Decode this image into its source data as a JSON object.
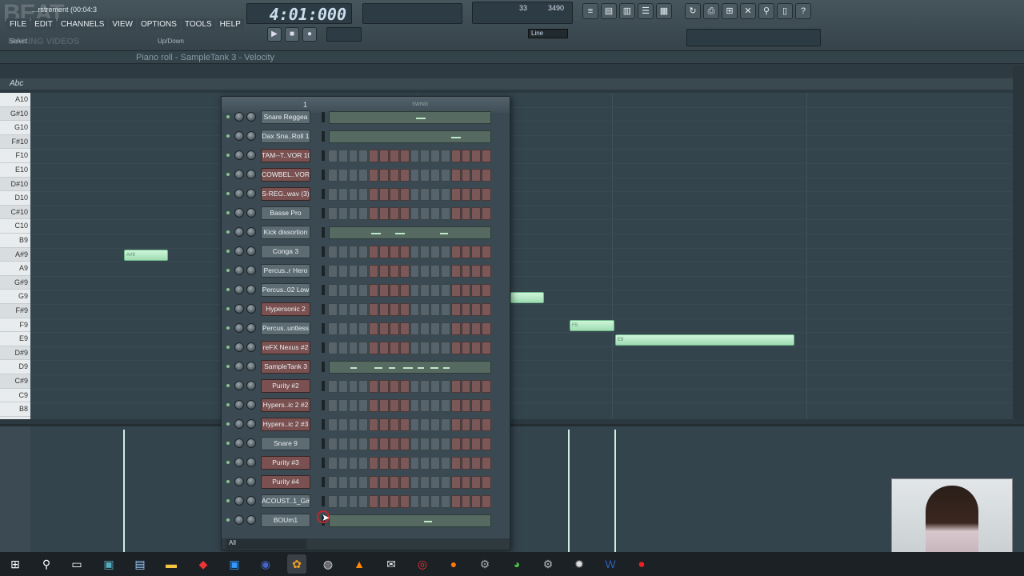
{
  "topbar": {
    "watermark": "BEAT",
    "watermark_sub": "MAKING VIDEOS",
    "hint": "...rstrement (00:04:3",
    "menu": [
      "FILE",
      "EDIT",
      "CHANNELS",
      "VIEW",
      "OPTIONS",
      "TOOLS",
      "HELP"
    ],
    "select_label": "Select",
    "updown_label": "Up/Down",
    "time": "4:01:000",
    "cpu_value": "33",
    "mem_value": "3490",
    "line_select": "Line"
  },
  "piano_roll": {
    "title": "Piano roll - SampleTank 3 - Velocity",
    "abc_label": "Abc",
    "keys": [
      {
        "label": "A10",
        "sharp": false
      },
      {
        "label": "G#10",
        "sharp": true
      },
      {
        "label": "G10",
        "sharp": false
      },
      {
        "label": "F#10",
        "sharp": true
      },
      {
        "label": "F10",
        "sharp": false
      },
      {
        "label": "E10",
        "sharp": false
      },
      {
        "label": "D#10",
        "sharp": true
      },
      {
        "label": "D10",
        "sharp": false
      },
      {
        "label": "C#10",
        "sharp": true
      },
      {
        "label": "C10",
        "sharp": false
      },
      {
        "label": "B9",
        "sharp": false
      },
      {
        "label": "A#9",
        "sharp": true
      },
      {
        "label": "A9",
        "sharp": false
      },
      {
        "label": "G#9",
        "sharp": true
      },
      {
        "label": "G9",
        "sharp": false
      },
      {
        "label": "F#9",
        "sharp": true
      },
      {
        "label": "F9",
        "sharp": false
      },
      {
        "label": "E9",
        "sharp": false
      },
      {
        "label": "D#9",
        "sharp": true
      },
      {
        "label": "D9",
        "sharp": false
      },
      {
        "label": "C#9",
        "sharp": true
      },
      {
        "label": "C9",
        "sharp": false
      },
      {
        "label": "B8",
        "sharp": false
      }
    ],
    "notes": [
      "A#9",
      "",
      "F9",
      "E9"
    ]
  },
  "channel_rack": {
    "header_label": "1",
    "swing_label": "SWING",
    "filter": "All",
    "channels": [
      {
        "name": "Snare Reggea",
        "color": "grey",
        "mode": "mini"
      },
      {
        "name": "Dax Sna..Roll 1",
        "color": "grey",
        "mode": "mini"
      },
      {
        "name": "TAM--T..VOR 10",
        "color": "red",
        "mode": "steps"
      },
      {
        "name": "COWBEL..VOR 2",
        "color": "red",
        "mode": "steps"
      },
      {
        "name": "S-REG..wav (3)",
        "color": "red",
        "mode": "steps"
      },
      {
        "name": "Basse Pro",
        "color": "grey",
        "mode": "steps"
      },
      {
        "name": "Kick dissortion",
        "color": "grey",
        "mode": "mini"
      },
      {
        "name": "Conga 3",
        "color": "grey",
        "mode": "steps"
      },
      {
        "name": "Percus..r Hero",
        "color": "grey",
        "mode": "steps"
      },
      {
        "name": "Percus..02 Low",
        "color": "grey",
        "mode": "steps"
      },
      {
        "name": "Hypersonic 2",
        "color": "red",
        "mode": "steps"
      },
      {
        "name": "Percus..untless",
        "color": "grey",
        "mode": "steps"
      },
      {
        "name": "reFX Nexus #2",
        "color": "red",
        "mode": "steps"
      },
      {
        "name": "SampleTank 3",
        "color": "red",
        "mode": "mini"
      },
      {
        "name": "Purity #2",
        "color": "red",
        "mode": "steps"
      },
      {
        "name": "Hypers..ic 2 #2",
        "color": "red",
        "mode": "steps"
      },
      {
        "name": "Hypers..ic 2 #3",
        "color": "red",
        "mode": "steps"
      },
      {
        "name": "Snare 9",
        "color": "grey",
        "mode": "steps"
      },
      {
        "name": "Purity #3",
        "color": "red",
        "mode": "steps"
      },
      {
        "name": "Purity #4",
        "color": "red",
        "mode": "steps"
      },
      {
        "name": "ACOUST..1_G#3",
        "color": "grey",
        "mode": "steps"
      },
      {
        "name": "BOUm1",
        "color": "grey",
        "mode": "mini"
      }
    ]
  },
  "colors": {
    "note": "#b3ecc4",
    "accent_red": "#7a5050",
    "bg": "#34444c"
  }
}
